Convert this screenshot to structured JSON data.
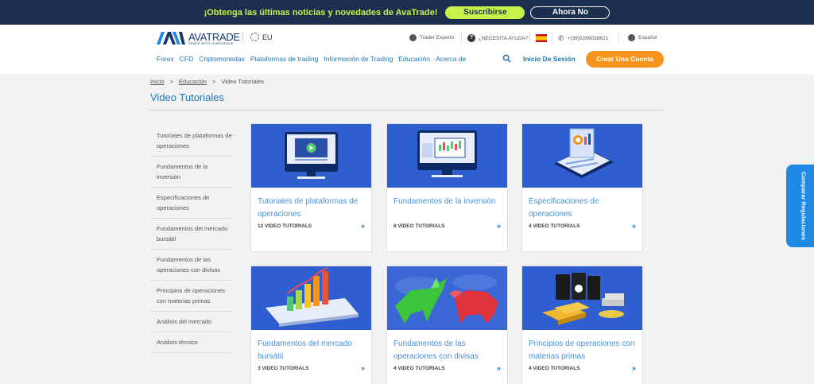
{
  "promo": {
    "text": "¡Obtenga las últimas noticias y novedades de AvaTrade!",
    "subscribe_label": "Suscribirse",
    "dismiss_label": "Ahora No"
  },
  "header": {
    "logo_name": "AVATRADE",
    "logo_tagline": "TRADE WITH CONFIDENCE",
    "region": "EU",
    "utilities": {
      "expert": "Trader Experto",
      "help": "¿NECESITA AYUDA?",
      "phone": "+(39)0289038621",
      "language": "Español"
    },
    "nav": [
      "Forex",
      "CFD",
      "Criptomonedas",
      "Plataformas de trading",
      "Información de Trading",
      "Educación",
      "Acerca de"
    ],
    "login_label": "Inicio De Sesión",
    "cta_label": "Crear Una Cuenta"
  },
  "breadcrumb": {
    "home": "Inicio",
    "education": "Educación",
    "current": "Video Tutoriales"
  },
  "page_title": "Video Tutoriales",
  "sidebar": [
    "Tutoriales de plataformas de operaciones",
    "Fundamentos de la inversión",
    "Especificaciones de operaciones",
    "Fundamentos del mercado bursátil",
    "Fundamentos de las operaciones con divisas",
    "Principios de operaciones con materias primas",
    "Análisis del mercado",
    "Análisis técnico"
  ],
  "cards": [
    {
      "title": "Tutoriales de plataformas de operaciones",
      "count": "12 VIDEO TUTORIALS",
      "image": "video-player-monitor"
    },
    {
      "title": "Fundamentos de la inversión",
      "count": "8 VIDEO TUTORIALS",
      "image": "candlestick-chart-monitor"
    },
    {
      "title": "Especificaciones de operaciones",
      "count": "4 VIDEO TUTORIALS",
      "image": "isometric-dashboard"
    },
    {
      "title": "Fundamentos del mercado bursátil",
      "count": "3 VIDEO TUTORIALS",
      "image": "phone-bar-chart"
    },
    {
      "title": "Fundamentos de las operaciones con divisas",
      "count": "4 VIDEO TUTORIALS",
      "image": "bull-and-bear"
    },
    {
      "title": "Principios de operaciones con materias primas",
      "count": "4 VIDEO TUTORIALS",
      "image": "oil-barrels-gold"
    }
  ],
  "side_tab_label": "Comparar Regulaciones",
  "colors": {
    "navy": "#1c2f4f",
    "lime": "#c7f24a",
    "link_blue": "#1f77b4",
    "card_title": "#4a8fd4",
    "card_image_bg": "#2f5ed1",
    "cta_orange": "#f7941d",
    "side_tab": "#1e88e5"
  }
}
